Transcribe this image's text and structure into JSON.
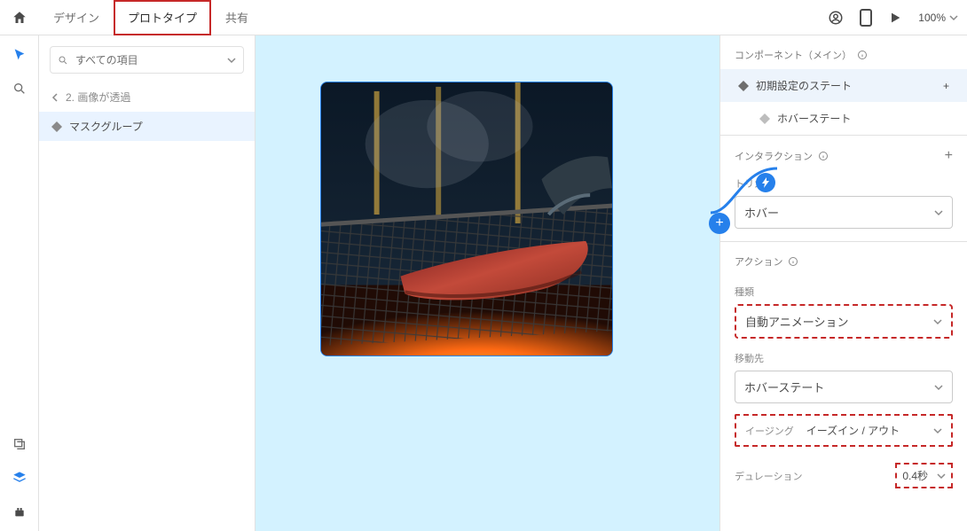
{
  "toolbar": {
    "tabs": {
      "design": "デザイン",
      "prototype": "プロトタイプ",
      "share": "共有"
    },
    "zoom": "100%"
  },
  "sidebar": {
    "search_placeholder": "すべての項目",
    "breadcrumb": "2. 画像が透過",
    "layer": "マスクグループ"
  },
  "states_panel": {
    "header": "コンポーネント（メイン）",
    "default_state": "初期設定のステート",
    "hover_state": "ホバーステート"
  },
  "interaction_panel": {
    "header": "インタラクション",
    "trigger_label": "トリガー",
    "trigger_value": "ホバー"
  },
  "action_panel": {
    "header": "アクション",
    "type_label": "種類",
    "type_value": "自動アニメーション",
    "destination_label": "移動先",
    "destination_value": "ホバーステート",
    "easing_label": "イージング",
    "easing_value": "イーズイン / アウト",
    "duration_label": "デュレーション",
    "duration_value": "0.4秒"
  }
}
